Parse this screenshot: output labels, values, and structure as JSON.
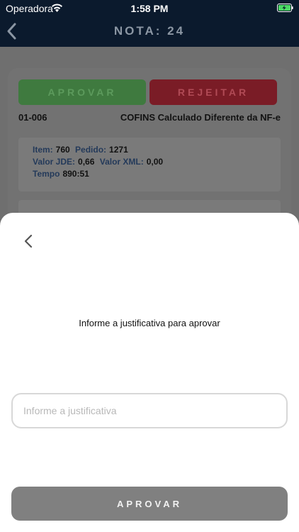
{
  "status_bar": {
    "carrier": "Operadora",
    "time": "1:58 PM"
  },
  "nav": {
    "title": "NOTA: 24"
  },
  "card": {
    "approve_label": "APROVAR",
    "reject_label": "REJEITAR",
    "code": "01-006",
    "description": "COFINS Calculado Diferente da NF-e",
    "info": {
      "item_label": "Item:",
      "item_value": "760",
      "pedido_label": "Pedido:",
      "pedido_value": "1271",
      "valor_jde_label": "Valor JDE:",
      "valor_jde_value": "0,66",
      "valor_xml_label": "Valor XML:",
      "valor_xml_value": "0,00",
      "tempo_label": "Tempo",
      "tempo_value": "890:51"
    }
  },
  "sheet": {
    "prompt": "Informe a justificativa para aprovar",
    "input_placeholder": "Informe a justificativa",
    "input_value": "",
    "approve_label": "APROVAR"
  },
  "colors": {
    "nav_bg": "#0b1a2d",
    "approve_green": "#3f7a3f",
    "reject_red": "#7a1c26",
    "battery_green": "#4cd964"
  }
}
